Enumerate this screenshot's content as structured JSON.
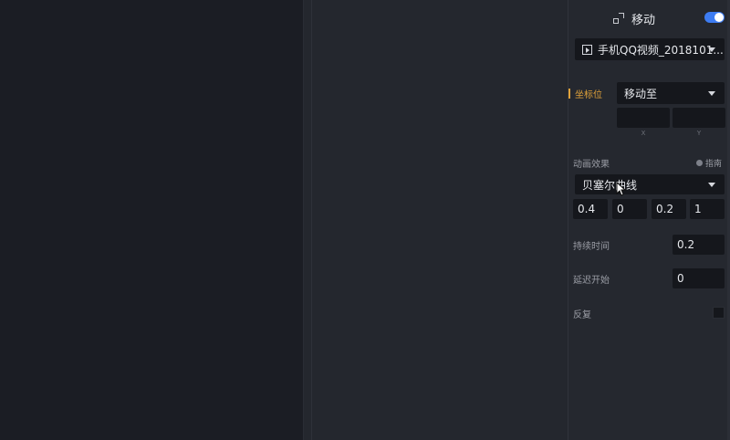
{
  "panel": {
    "title": "移动",
    "toggle_on": true,
    "accent_color": "#3d7cf2",
    "video_selector": "手机QQ视频_2018101..."
  },
  "coordinate": {
    "label": "坐标位",
    "mode": "移动至",
    "x_value": "",
    "y_value": "",
    "x_caption": "X",
    "y_caption": "Y"
  },
  "animation": {
    "label": "动画效果",
    "guide_label": "指南",
    "easing": "贝塞尔曲线",
    "bezier": [
      "0.4",
      "0",
      "0.2",
      "1"
    ]
  },
  "duration": {
    "label": "持续时间",
    "value": "0.2"
  },
  "delay": {
    "label": "延迟开始",
    "value": "0"
  },
  "repeat": {
    "label": "反复",
    "checked": false
  }
}
